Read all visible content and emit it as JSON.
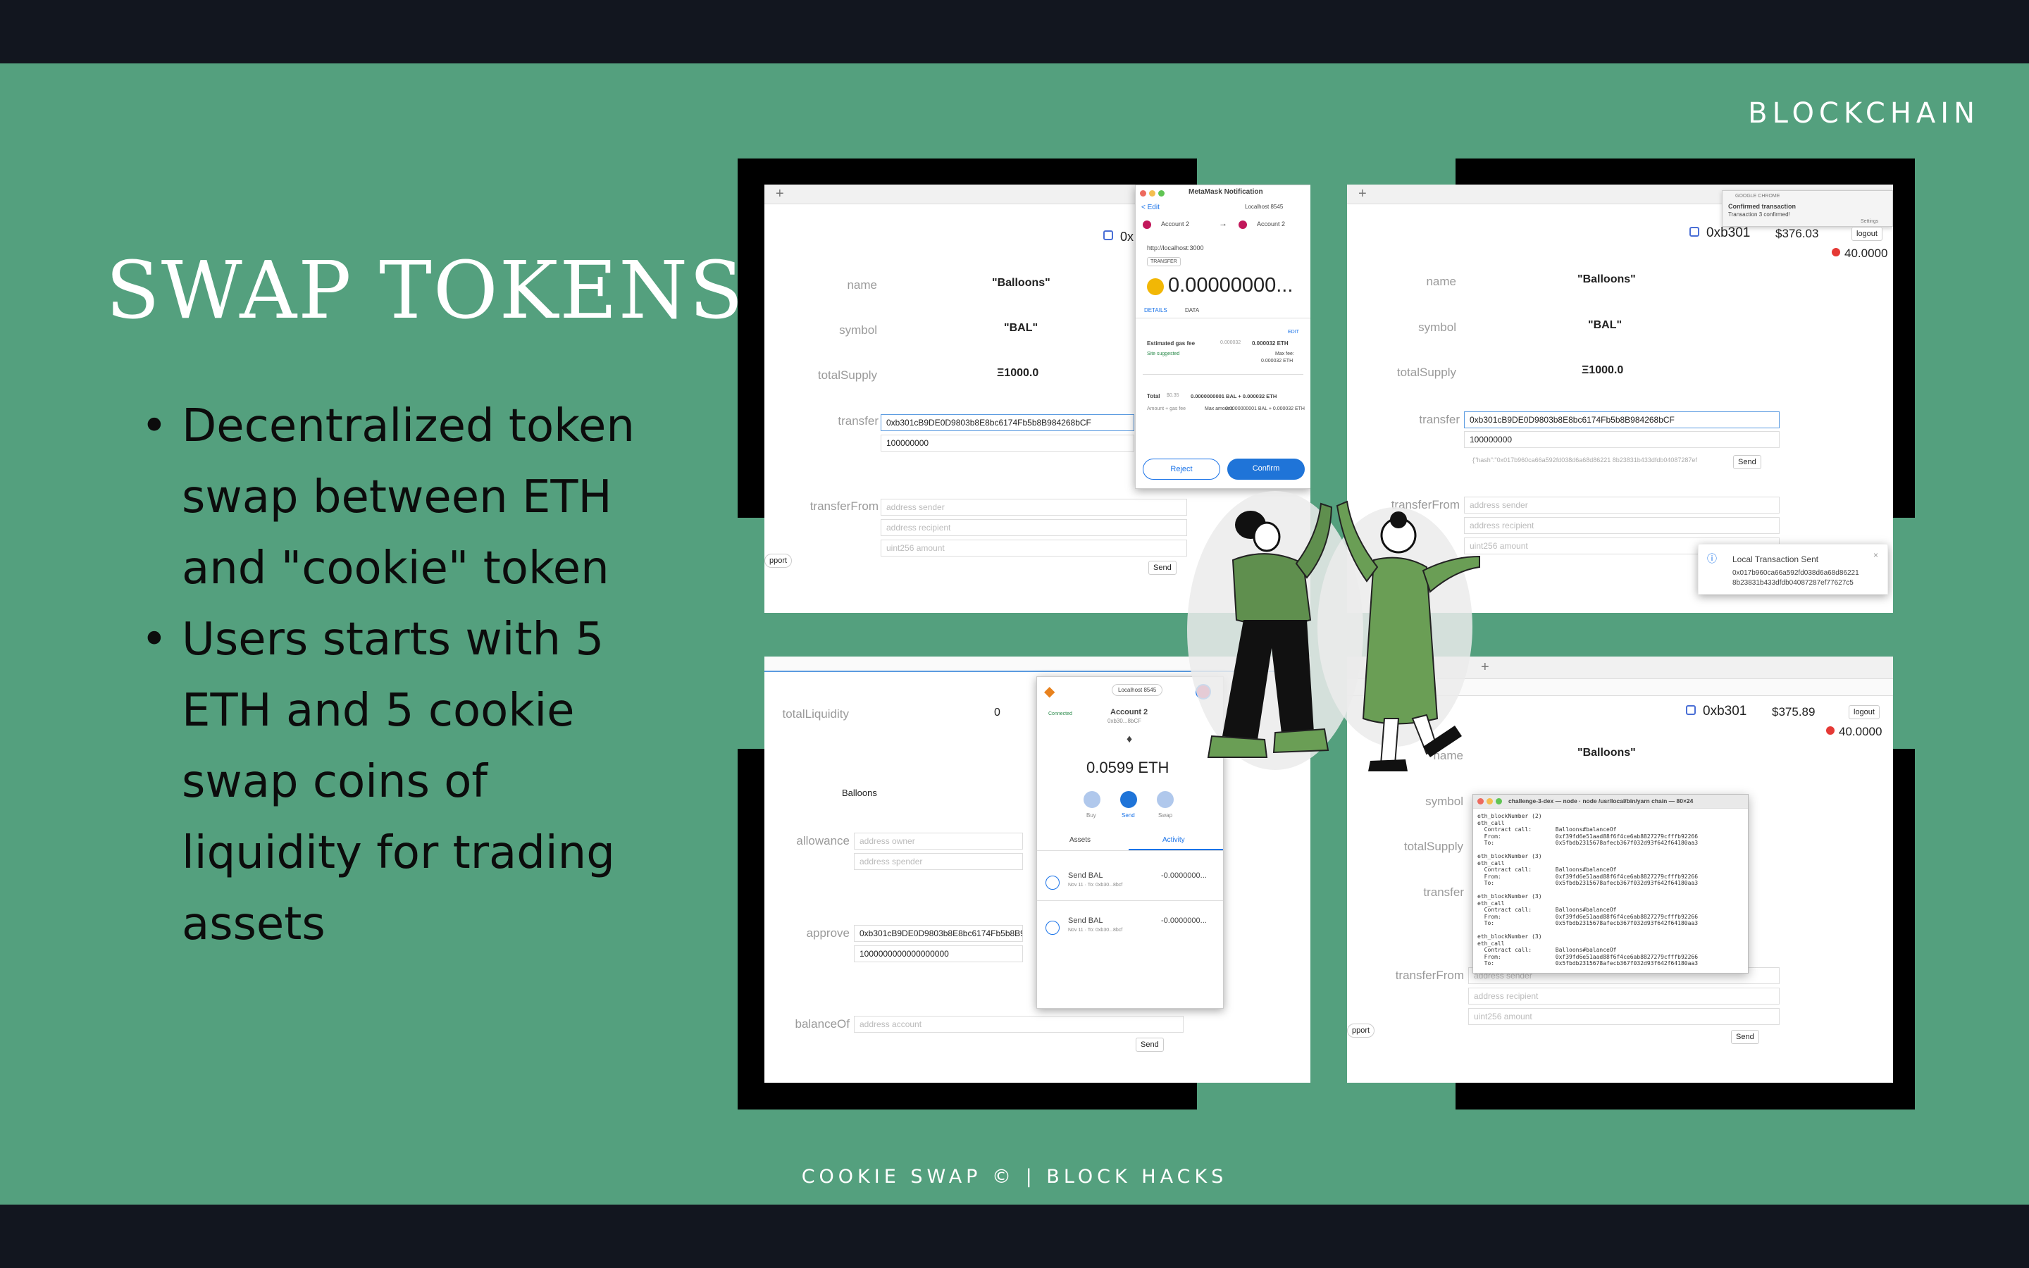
{
  "slide": {
    "brand": "BLOCKCHAIN",
    "title": "SWAP TOKENS",
    "bullets": [
      "Decentralized token swap between ETH and \"cookie\" token",
      "Users starts with 5 ETH and 5 cookie swap coins of liquidity for trading assets"
    ],
    "footer": "COOKIE SWAP © | BLOCK HACKS"
  },
  "colors": {
    "background": "#54a07e",
    "bars": "#12161f",
    "title": "#ffffff",
    "text": "#0c0c0c"
  },
  "shot1": {
    "labels": {
      "name": "name",
      "symbol": "symbol",
      "totalSupply": "totalSupply",
      "transfer": "transfer",
      "transferFrom": "transferFrom"
    },
    "values": {
      "name": "\"Balloons\"",
      "symbol": "\"BAL\"",
      "totalSupply": "Ξ1000.0"
    },
    "addr_short": "0x",
    "transfer_to": "0xb301cB9DE0D9803b8E8bc6174Fb5b8B984268bCF",
    "transfer_amount": "100000000",
    "ph_sender": "address sender",
    "ph_recipient": "address recipient",
    "ph_amount": "uint256 amount",
    "send": "Send",
    "support": "pport",
    "metamask": {
      "title": "MetaMask Notification",
      "edit": "< Edit",
      "network": "Localhost 8545",
      "from": "Account 2",
      "to": "Account 2",
      "origin": "http://localhost:3000",
      "badge": "TRANSFER",
      "amount": "0.00000000...",
      "tab_details": "DETAILS",
      "tab_data": "DATA",
      "edit_small": "EDIT",
      "gas_label": "Estimated gas fee",
      "gas_small": "0.000032",
      "gas_value": "0.000032 ETH",
      "site_suggested": "Site suggested",
      "max_fee": "Max fee:",
      "max_fee_value": "0.000032 ETH",
      "total_label": "Total",
      "total_small": "$0.35",
      "total_value": "0.0000000001 BAL + 0.000032 ETH",
      "amount_gas": "Amount + gas fee",
      "max_amount": "Max amount:",
      "max_amount_value": "0.0000000001 BAL + 0.000032 ETH",
      "reject": "Reject",
      "confirm": "Confirm"
    }
  },
  "shot2": {
    "addr": "0xb301",
    "balance": "$376.03",
    "logout": "logout",
    "token_balance": "40.0000",
    "chrome_app": "GOOGLE CHROME",
    "notif_title": "Confirmed transaction",
    "notif_body": "Transaction 3 confirmed!",
    "notif_settings": "Settings",
    "labels": {
      "name": "name",
      "symbol": "symbol",
      "totalSupply": "totalSupply",
      "transfer": "transfer",
      "transferFrom": "transferFrom"
    },
    "values": {
      "name": "\"Balloons\"",
      "symbol": "\"BAL\"",
      "totalSupply": "Ξ1000.0"
    },
    "transfer_to": "0xb301cB9DE0D9803b8E8bc6174Fb5b8B984268bCF",
    "transfer_amount": "100000000",
    "hash_line": "{\"hash\":\"0x017b960ca66a592fd038d6a68d86221 8b23831b433dfdb04087287ef",
    "send": "Send",
    "ph_sender": "address sender",
    "ph_recipient": "address recipient",
    "ph_amount": "uint256 amount",
    "toast_title": "Local Transaction Sent",
    "toast_hash": "0x017b960ca66a592fd038d6a68d86221 8b23831b433dfdb04087287ef77627c5"
  },
  "shot3": {
    "labels": {
      "totalLiquidity": "totalLiquidity",
      "allowance": "allowance",
      "approve": "approve",
      "balanceOf": "balanceOf"
    },
    "total_liquidity": "0",
    "balloons": "Balloons",
    "ph_owner": "address owner",
    "ph_spender": "address spender",
    "approve_addr": "0xb301cB9DE0D9803b8E8bc6174Fb5b8B98",
    "approve_amount": "1000000000000000000",
    "ph_account": "address account",
    "send": "Send",
    "wallet": {
      "network": "Localhost 8545",
      "connected": "Connected",
      "account": "Account 2",
      "account_addr": "0xb30...8bCF",
      "balance": "0.0599 ETH",
      "buy": "Buy",
      "send": "Send",
      "swap": "Swap",
      "tab_assets": "Assets",
      "tab_activity": "Activity",
      "tx1_title": "Send BAL",
      "tx1_sub": "Nov 11 · To: 0xb30...8bcf",
      "tx1_amount": "-0.0000000...",
      "tx2_title": "Send BAL",
      "tx2_sub": "Nov 11 · To: 0xb30...8bcf",
      "tx2_amount": "-0.0000000..."
    }
  },
  "shot4": {
    "addr": "0xb301",
    "balance": "$375.89",
    "logout": "logout",
    "token_balance": "40.0000",
    "labels": {
      "name": "name",
      "symbol": "symbol",
      "totalSupply": "totalSupply",
      "transfer": "transfer",
      "transferFrom": "transferFrom"
    },
    "name_value": "\"Balloons\"",
    "ph_sender": "address sender",
    "ph_recipient": "address recipient",
    "ph_amount": "uint256 amount",
    "send": "Send",
    "support": "pport",
    "terminal": {
      "title": "challenge-3-dex — node · node /usr/local/bin/yarn chain — 80×24",
      "lines": "eth_blockNumber (2)\neth_call\n  Contract call:       Balloons#balanceOf\n  From:                0xf39fd6e51aad88f6f4ce6ab8827279cfffb92266\n  To:                  0x5fbdb2315678afecb367f032d93f642f64180aa3\n\neth_blockNumber (3)\neth_call\n  Contract call:       Balloons#balanceOf\n  From:                0xf39fd6e51aad88f6f4ce6ab8827279cfffb92266\n  To:                  0x5fbdb2315678afecb367f032d93f642f64180aa3\n\neth_blockNumber (3)\neth_call\n  Contract call:       Balloons#balanceOf\n  From:                0xf39fd6e51aad88f6f4ce6ab8827279cfffb92266\n  To:                  0x5fbdb2315678afecb367f032d93f642f64180aa3\n\neth_blockNumber (3)\neth_call\n  Contract call:       Balloons#balanceOf\n  From:                0xf39fd6e51aad88f6f4ce6ab8827279cfffb92266\n  To:                  0x5fbdb2315678afecb367f032d93f642f64180aa3"
    }
  }
}
